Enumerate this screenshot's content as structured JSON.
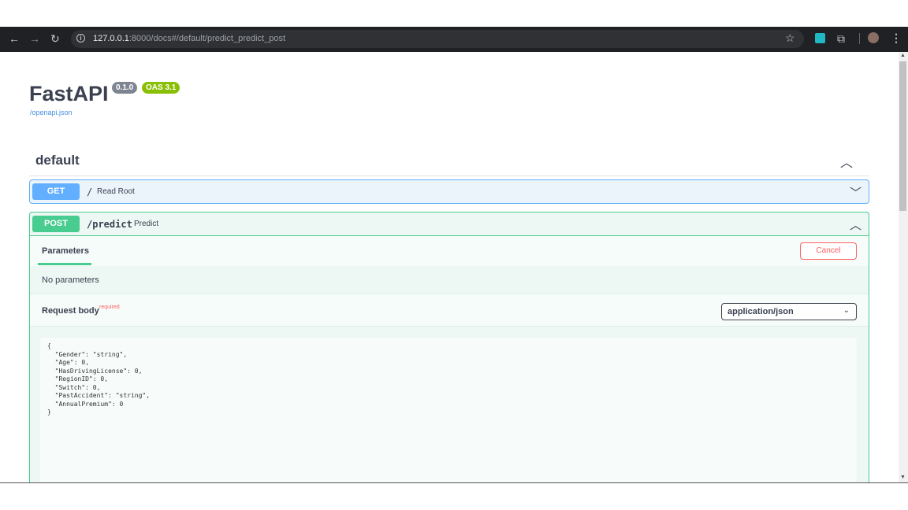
{
  "browser": {
    "url_host": "127.0.0.1",
    "url_rest": ":8000/docs#/default/predict_predict_post",
    "nav": {
      "back": "←",
      "forward": "→",
      "reload": "↻"
    },
    "icons": {
      "star": "☆",
      "menu": "⋮",
      "extensions": "⧉",
      "info": "i"
    }
  },
  "api": {
    "title": "FastAPI",
    "version": "0.1.0",
    "oas": "OAS 3.1",
    "openapi_link": "/openapi.json"
  },
  "tag": {
    "name": "default",
    "chevron": "︿"
  },
  "operations": {
    "get": {
      "method": "GET",
      "path": "/",
      "summary": "Read Root",
      "chevron": "﹀"
    },
    "post": {
      "method": "POST",
      "path": "/predict",
      "summary": "Predict",
      "chevron": "︿"
    }
  },
  "post_panel": {
    "parameters_tab": "Parameters",
    "cancel": "Cancel",
    "no_parameters": "No parameters",
    "request_body_label": "Request body",
    "required": "required",
    "content_type": "application/json",
    "caret": "⌄",
    "body": "{\n  \"Gender\": \"string\",\n  \"Age\": 0,\n  \"HasDrivingLicense\": 0,\n  \"RegionID\": 0,\n  \"Switch\": 0,\n  \"PastAccident\": \"string\",\n  \"AnnualPremium\": 0\n}"
  },
  "colors": {
    "get": "#61affe",
    "post": "#49cc90",
    "cancel": "#ff6060",
    "oas_badge": "#89bf04",
    "version_badge": "#7d8492"
  }
}
